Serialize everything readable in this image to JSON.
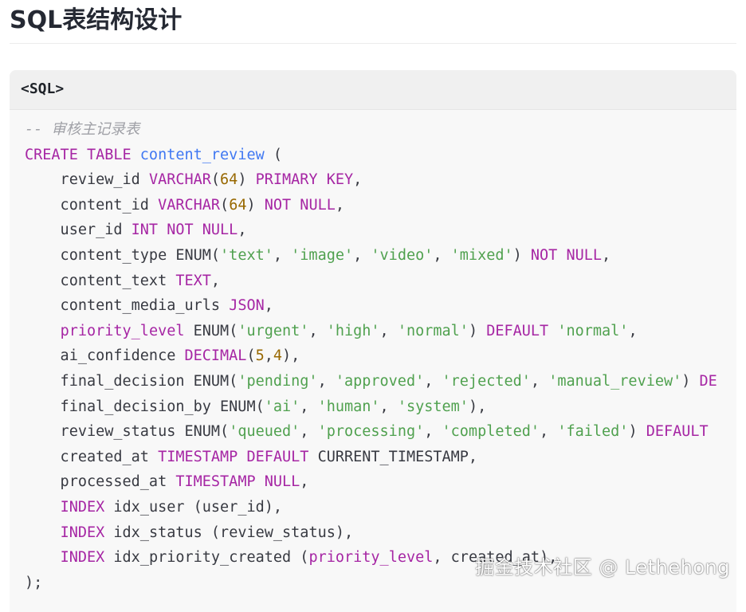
{
  "heading": "SQL表结构设计",
  "code_block": {
    "language_label": "<SQL>",
    "lines": [
      [
        {
          "t": "-- 审核主记录表",
          "c": "cm"
        }
      ],
      [
        {
          "t": "CREATE TABLE",
          "c": "kw"
        },
        {
          "t": " "
        },
        {
          "t": "content_review",
          "c": "fn"
        },
        {
          "t": " ("
        }
      ],
      [
        {
          "t": "    review_id "
        },
        {
          "t": "VARCHAR",
          "c": "kw"
        },
        {
          "t": "("
        },
        {
          "t": "64",
          "c": "num"
        },
        {
          "t": ") "
        },
        {
          "t": "PRIMARY KEY",
          "c": "kw"
        },
        {
          "t": ","
        }
      ],
      [
        {
          "t": "    content_id "
        },
        {
          "t": "VARCHAR",
          "c": "kw"
        },
        {
          "t": "("
        },
        {
          "t": "64",
          "c": "num"
        },
        {
          "t": ") "
        },
        {
          "t": "NOT NULL",
          "c": "kw"
        },
        {
          "t": ","
        }
      ],
      [
        {
          "t": "    user_id "
        },
        {
          "t": "INT NOT NULL",
          "c": "kw"
        },
        {
          "t": ","
        }
      ],
      [
        {
          "t": "    content_type ENUM("
        },
        {
          "t": "'text'",
          "c": "str"
        },
        {
          "t": ", "
        },
        {
          "t": "'image'",
          "c": "str"
        },
        {
          "t": ", "
        },
        {
          "t": "'video'",
          "c": "str"
        },
        {
          "t": ", "
        },
        {
          "t": "'mixed'",
          "c": "str"
        },
        {
          "t": ") "
        },
        {
          "t": "NOT NULL",
          "c": "kw"
        },
        {
          "t": ","
        }
      ],
      [
        {
          "t": "    content_text "
        },
        {
          "t": "TEXT",
          "c": "kw"
        },
        {
          "t": ","
        }
      ],
      [
        {
          "t": "    content_media_urls "
        },
        {
          "t": "JSON",
          "c": "kw"
        },
        {
          "t": ","
        }
      ],
      [
        {
          "t": "    "
        },
        {
          "t": "priority_level",
          "c": "kw"
        },
        {
          "t": " ENUM("
        },
        {
          "t": "'urgent'",
          "c": "str"
        },
        {
          "t": ", "
        },
        {
          "t": "'high'",
          "c": "str"
        },
        {
          "t": ", "
        },
        {
          "t": "'normal'",
          "c": "str"
        },
        {
          "t": ") "
        },
        {
          "t": "DEFAULT",
          "c": "kw"
        },
        {
          "t": " "
        },
        {
          "t": "'normal'",
          "c": "str"
        },
        {
          "t": ","
        }
      ],
      [
        {
          "t": "    ai_confidence "
        },
        {
          "t": "DECIMAL",
          "c": "kw"
        },
        {
          "t": "("
        },
        {
          "t": "5",
          "c": "num"
        },
        {
          "t": ","
        },
        {
          "t": "4",
          "c": "num"
        },
        {
          "t": "),"
        }
      ],
      [
        {
          "t": "    final_decision ENUM("
        },
        {
          "t": "'pending'",
          "c": "str"
        },
        {
          "t": ", "
        },
        {
          "t": "'approved'",
          "c": "str"
        },
        {
          "t": ", "
        },
        {
          "t": "'rejected'",
          "c": "str"
        },
        {
          "t": ", "
        },
        {
          "t": "'manual_review'",
          "c": "str"
        },
        {
          "t": ") "
        },
        {
          "t": "DE",
          "c": "kw"
        }
      ],
      [
        {
          "t": "    final_decision_by ENUM("
        },
        {
          "t": "'ai'",
          "c": "str"
        },
        {
          "t": ", "
        },
        {
          "t": "'human'",
          "c": "str"
        },
        {
          "t": ", "
        },
        {
          "t": "'system'",
          "c": "str"
        },
        {
          "t": "),"
        }
      ],
      [
        {
          "t": "    review_status ENUM("
        },
        {
          "t": "'queued'",
          "c": "str"
        },
        {
          "t": ", "
        },
        {
          "t": "'processing'",
          "c": "str"
        },
        {
          "t": ", "
        },
        {
          "t": "'completed'",
          "c": "str"
        },
        {
          "t": ", "
        },
        {
          "t": "'failed'",
          "c": "str"
        },
        {
          "t": ") "
        },
        {
          "t": "DEFAULT",
          "c": "kw"
        }
      ],
      [
        {
          "t": "    created_at "
        },
        {
          "t": "TIMESTAMP DEFAULT",
          "c": "kw"
        },
        {
          "t": " CURRENT_TIMESTAMP,"
        }
      ],
      [
        {
          "t": "    processed_at "
        },
        {
          "t": "TIMESTAMP NULL",
          "c": "kw"
        },
        {
          "t": ","
        }
      ],
      [
        {
          "t": "    "
        },
        {
          "t": "INDEX",
          "c": "kw"
        },
        {
          "t": " idx_user (user_id),"
        }
      ],
      [
        {
          "t": "    "
        },
        {
          "t": "INDEX",
          "c": "kw"
        },
        {
          "t": " idx_status (review_status),"
        }
      ],
      [
        {
          "t": "    "
        },
        {
          "t": "INDEX",
          "c": "kw"
        },
        {
          "t": " idx_priority_created ("
        },
        {
          "t": "priority_level",
          "c": "kw"
        },
        {
          "t": ", created_at),"
        }
      ],
      [
        {
          "t": ");"
        }
      ]
    ]
  },
  "watermark": "掘金技术社区 @ Lethehong",
  "colors": {
    "keyword": "#a626a4",
    "string": "#50a14f",
    "number": "#986801",
    "table_name": "#4078f2",
    "comment": "#a0a1a7",
    "default_text": "#383a42",
    "code_background": "#f8f8f8",
    "header_background": "#f0f0f0"
  }
}
